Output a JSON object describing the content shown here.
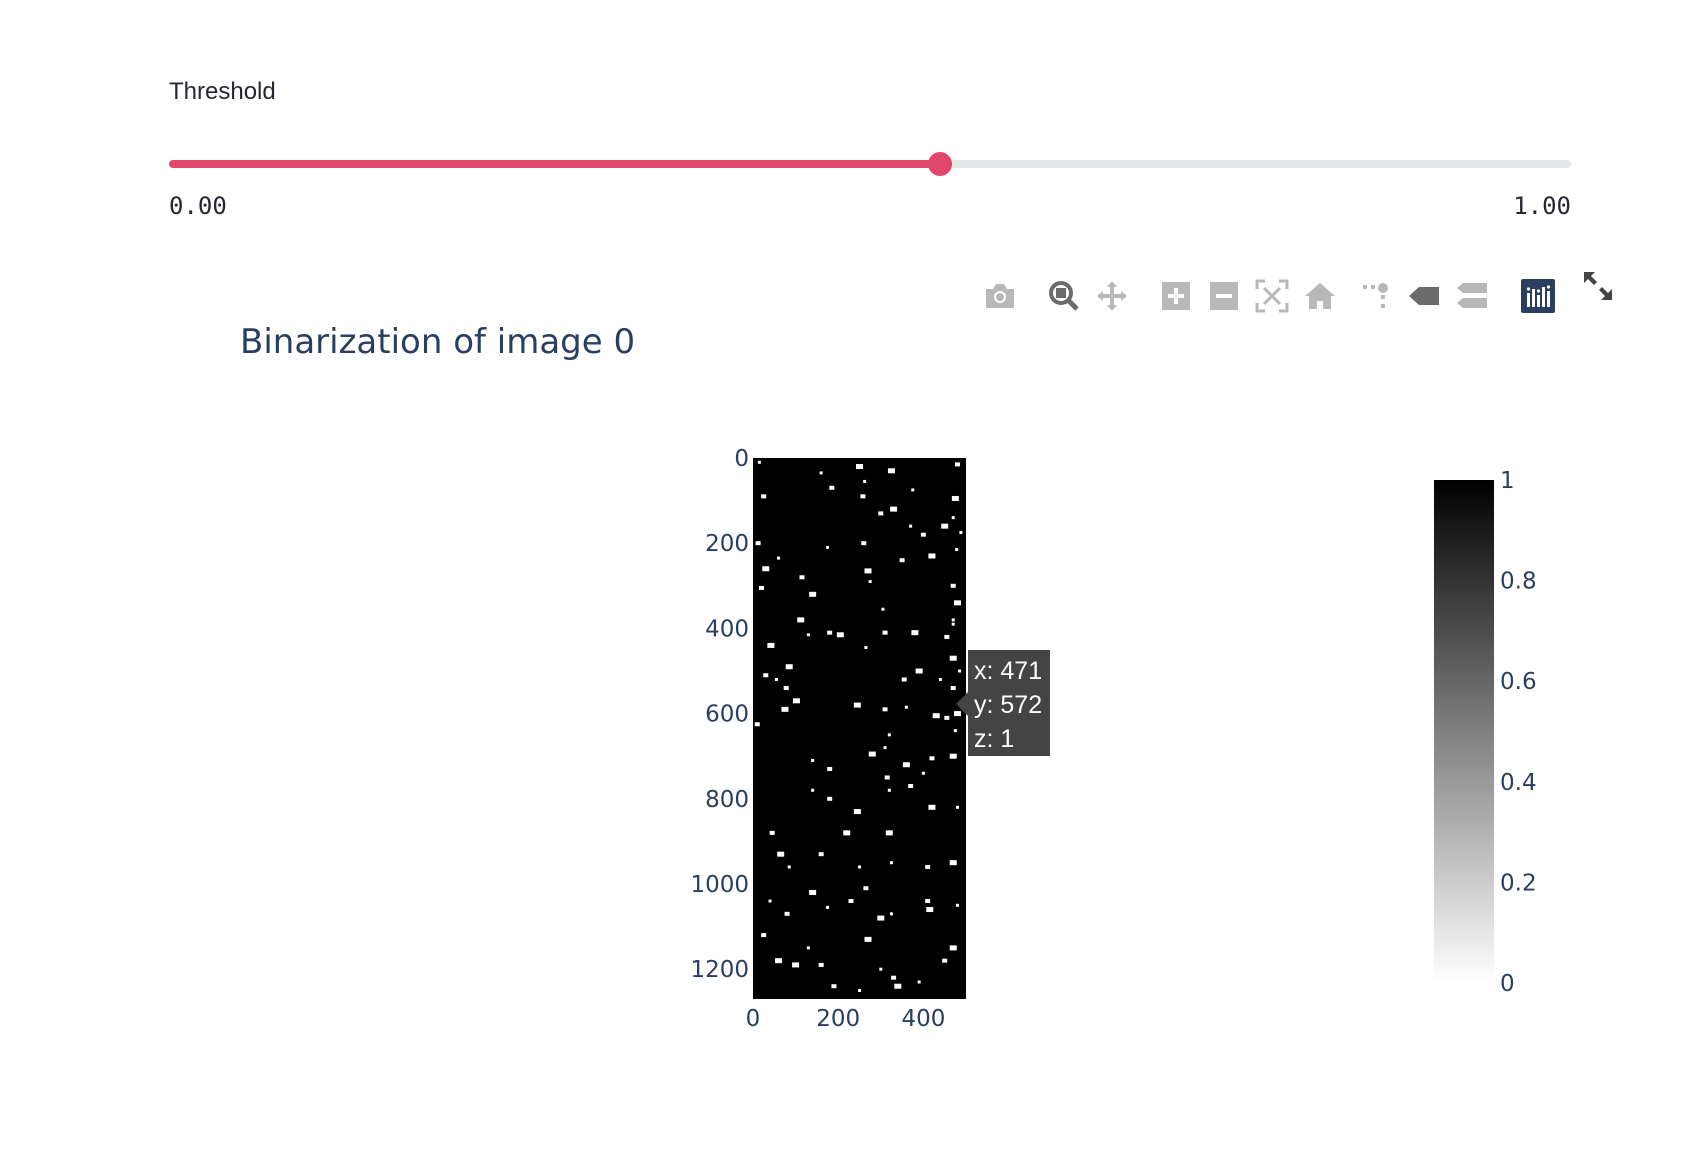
{
  "slider": {
    "label": "Threshold",
    "value": 0.55,
    "min_label": "0.00",
    "max_label": "1.00",
    "accent_color": "#e1466b",
    "track_color": "#e6e7ea"
  },
  "modebar": {
    "buttons": [
      {
        "name": "camera-icon",
        "title": "Download plot as a png"
      },
      {
        "name": "zoom-icon",
        "title": "Zoom"
      },
      {
        "name": "pan-icon",
        "title": "Pan"
      },
      {
        "name": "zoom-in-icon",
        "title": "Zoom in"
      },
      {
        "name": "zoom-out-icon",
        "title": "Zoom out"
      },
      {
        "name": "autoscale-icon",
        "title": "Autoscale"
      },
      {
        "name": "home-icon",
        "title": "Reset axes"
      },
      {
        "name": "spike-lines-icon",
        "title": "Toggle Spike Lines"
      },
      {
        "name": "hover-closest-icon",
        "title": "Show closest data on hover"
      },
      {
        "name": "hover-compare-icon",
        "title": "Compare data on hover"
      },
      {
        "name": "plotly-logo-icon",
        "title": "Produced with Plotly"
      },
      {
        "name": "fullscreen-icon",
        "title": "View fullscreen"
      }
    ],
    "active_color": "#2a3f5f",
    "icon_color": "#b8b8b8"
  },
  "hover": {
    "x_line": "x: 471",
    "y_line": "y: 572",
    "z_line": "z: 1"
  },
  "chart_data": {
    "type": "heatmap",
    "title": "Binarization of image 0",
    "xlabel": "",
    "ylabel": "",
    "x_range": [
      0,
      500
    ],
    "y_range": [
      0,
      1270
    ],
    "y_reversed": true,
    "x_ticks": [
      "0",
      "200",
      "400"
    ],
    "y_ticks": [
      "0",
      "200",
      "400",
      "600",
      "800",
      "1000",
      "1200"
    ],
    "colorscale": "Greys",
    "z_range": [
      0,
      1
    ],
    "colorbar_ticks": [
      "0",
      "0.2",
      "0.4",
      "0.6",
      "0.8",
      "1"
    ],
    "background_value": 1,
    "foreground_value": 0,
    "white_specks": [
      [
        15,
        10
      ],
      [
        25,
        90
      ],
      [
        42,
        440
      ],
      [
        160,
        35
      ],
      [
        185,
        70
      ],
      [
        250,
        20
      ],
      [
        262,
        55
      ],
      [
        258,
        90
      ],
      [
        325,
        30
      ],
      [
        375,
        75
      ],
      [
        480,
        15
      ],
      [
        475,
        95
      ],
      [
        470,
        140
      ],
      [
        300,
        130
      ],
      [
        330,
        120
      ],
      [
        370,
        160
      ],
      [
        400,
        180
      ],
      [
        450,
        160
      ],
      [
        488,
        175
      ],
      [
        12,
        200
      ],
      [
        30,
        260
      ],
      [
        60,
        235
      ],
      [
        115,
        280
      ],
      [
        140,
        320
      ],
      [
        175,
        210
      ],
      [
        260,
        200
      ],
      [
        270,
        265
      ],
      [
        275,
        290
      ],
      [
        350,
        240
      ],
      [
        420,
        230
      ],
      [
        478,
        215
      ],
      [
        470,
        300
      ],
      [
        480,
        340
      ],
      [
        470,
        380
      ],
      [
        455,
        420
      ],
      [
        470,
        470
      ],
      [
        485,
        500
      ],
      [
        20,
        305
      ],
      [
        112,
        380
      ],
      [
        130,
        415
      ],
      [
        180,
        410
      ],
      [
        205,
        415
      ],
      [
        305,
        355
      ],
      [
        310,
        410
      ],
      [
        380,
        410
      ],
      [
        470,
        390
      ],
      [
        30,
        510
      ],
      [
        85,
        490
      ],
      [
        55,
        520
      ],
      [
        78,
        540
      ],
      [
        102,
        570
      ],
      [
        265,
        445
      ],
      [
        355,
        520
      ],
      [
        390,
        500
      ],
      [
        440,
        520
      ],
      [
        470,
        540
      ],
      [
        480,
        600
      ],
      [
        475,
        640
      ],
      [
        455,
        610
      ],
      [
        430,
        605
      ],
      [
        360,
        585
      ],
      [
        310,
        590
      ],
      [
        245,
        580
      ],
      [
        320,
        650
      ],
      [
        10,
        625
      ],
      [
        75,
        590
      ],
      [
        140,
        710
      ],
      [
        180,
        730
      ],
      [
        280,
        695
      ],
      [
        310,
        680
      ],
      [
        315,
        750
      ],
      [
        360,
        720
      ],
      [
        400,
        740
      ],
      [
        420,
        705
      ],
      [
        470,
        700
      ],
      [
        140,
        780
      ],
      [
        180,
        800
      ],
      [
        245,
        830
      ],
      [
        320,
        780
      ],
      [
        370,
        770
      ],
      [
        420,
        820
      ],
      [
        480,
        820
      ],
      [
        45,
        880
      ],
      [
        65,
        930
      ],
      [
        85,
        960
      ],
      [
        160,
        930
      ],
      [
        220,
        880
      ],
      [
        250,
        960
      ],
      [
        265,
        1010
      ],
      [
        320,
        880
      ],
      [
        325,
        950
      ],
      [
        410,
        960
      ],
      [
        470,
        950
      ],
      [
        40,
        1040
      ],
      [
        80,
        1070
      ],
      [
        140,
        1020
      ],
      [
        175,
        1055
      ],
      [
        230,
        1040
      ],
      [
        300,
        1080
      ],
      [
        325,
        1070
      ],
      [
        410,
        1040
      ],
      [
        415,
        1060
      ],
      [
        480,
        1050
      ],
      [
        25,
        1120
      ],
      [
        60,
        1180
      ],
      [
        130,
        1150
      ],
      [
        160,
        1190
      ],
      [
        270,
        1130
      ],
      [
        300,
        1200
      ],
      [
        330,
        1220
      ],
      [
        340,
        1240
      ],
      [
        250,
        1250
      ],
      [
        190,
        1240
      ],
      [
        100,
        1190
      ],
      [
        390,
        1230
      ],
      [
        450,
        1180
      ],
      [
        470,
        1150
      ]
    ]
  }
}
